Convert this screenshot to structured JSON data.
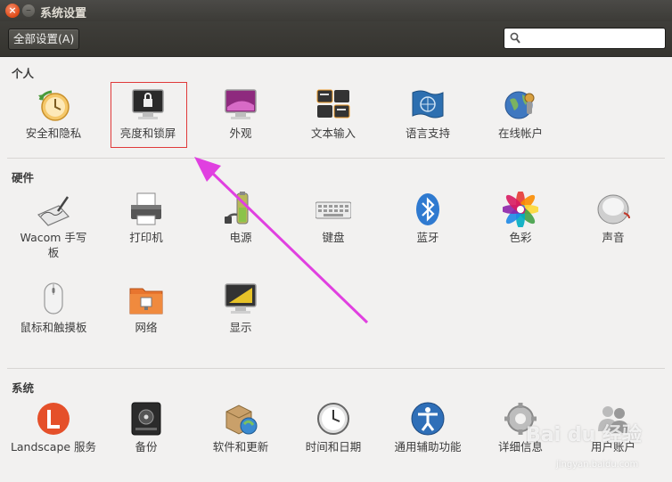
{
  "window": {
    "title": "系统设置",
    "close_glyph": "×",
    "min_glyph": "–"
  },
  "toolbar": {
    "all_settings_label": "全部设置(A)",
    "search_placeholder": ""
  },
  "sections": {
    "personal": {
      "title": "个人",
      "items": [
        {
          "label": "安全和隐私",
          "icon": "security-privacy-icon"
        },
        {
          "label": "亮度和锁屏",
          "icon": "brightness-lock-icon"
        },
        {
          "label": "外观",
          "icon": "appearance-icon"
        },
        {
          "label": "文本输入",
          "icon": "text-entry-icon"
        },
        {
          "label": "语言支持",
          "icon": "language-support-icon"
        },
        {
          "label": "在线帐户",
          "icon": "online-accounts-icon"
        }
      ]
    },
    "hardware": {
      "title": "硬件",
      "items": [
        {
          "label": "Wacom 手写板",
          "icon": "wacom-tablet-icon"
        },
        {
          "label": "打印机",
          "icon": "printer-icon"
        },
        {
          "label": "电源",
          "icon": "power-icon"
        },
        {
          "label": "键盘",
          "icon": "keyboard-icon"
        },
        {
          "label": "蓝牙",
          "icon": "bluetooth-icon"
        },
        {
          "label": "色彩",
          "icon": "color-icon"
        },
        {
          "label": "声音",
          "icon": "sound-icon"
        },
        {
          "label": "鼠标和触摸板",
          "icon": "mouse-touchpad-icon"
        },
        {
          "label": "网络",
          "icon": "network-icon"
        },
        {
          "label": "显示",
          "icon": "displays-icon"
        }
      ]
    },
    "system": {
      "title": "系统",
      "items": [
        {
          "label": "Landscape 服务",
          "icon": "landscape-icon"
        },
        {
          "label": "备份",
          "icon": "backup-icon"
        },
        {
          "label": "软件和更新",
          "icon": "software-updates-icon"
        },
        {
          "label": "时间和日期",
          "icon": "time-date-icon"
        },
        {
          "label": "通用辅助功能",
          "icon": "universal-access-icon"
        },
        {
          "label": "详细信息",
          "icon": "details-icon"
        },
        {
          "label": "用户账户",
          "icon": "user-accounts-icon"
        }
      ]
    }
  },
  "annotation": {
    "arrow_color": "#e040e0",
    "highlight_color": "#e03a3a"
  },
  "watermark": {
    "brand": "Bai du 经验",
    "url": "jingyan.baidu.com"
  }
}
